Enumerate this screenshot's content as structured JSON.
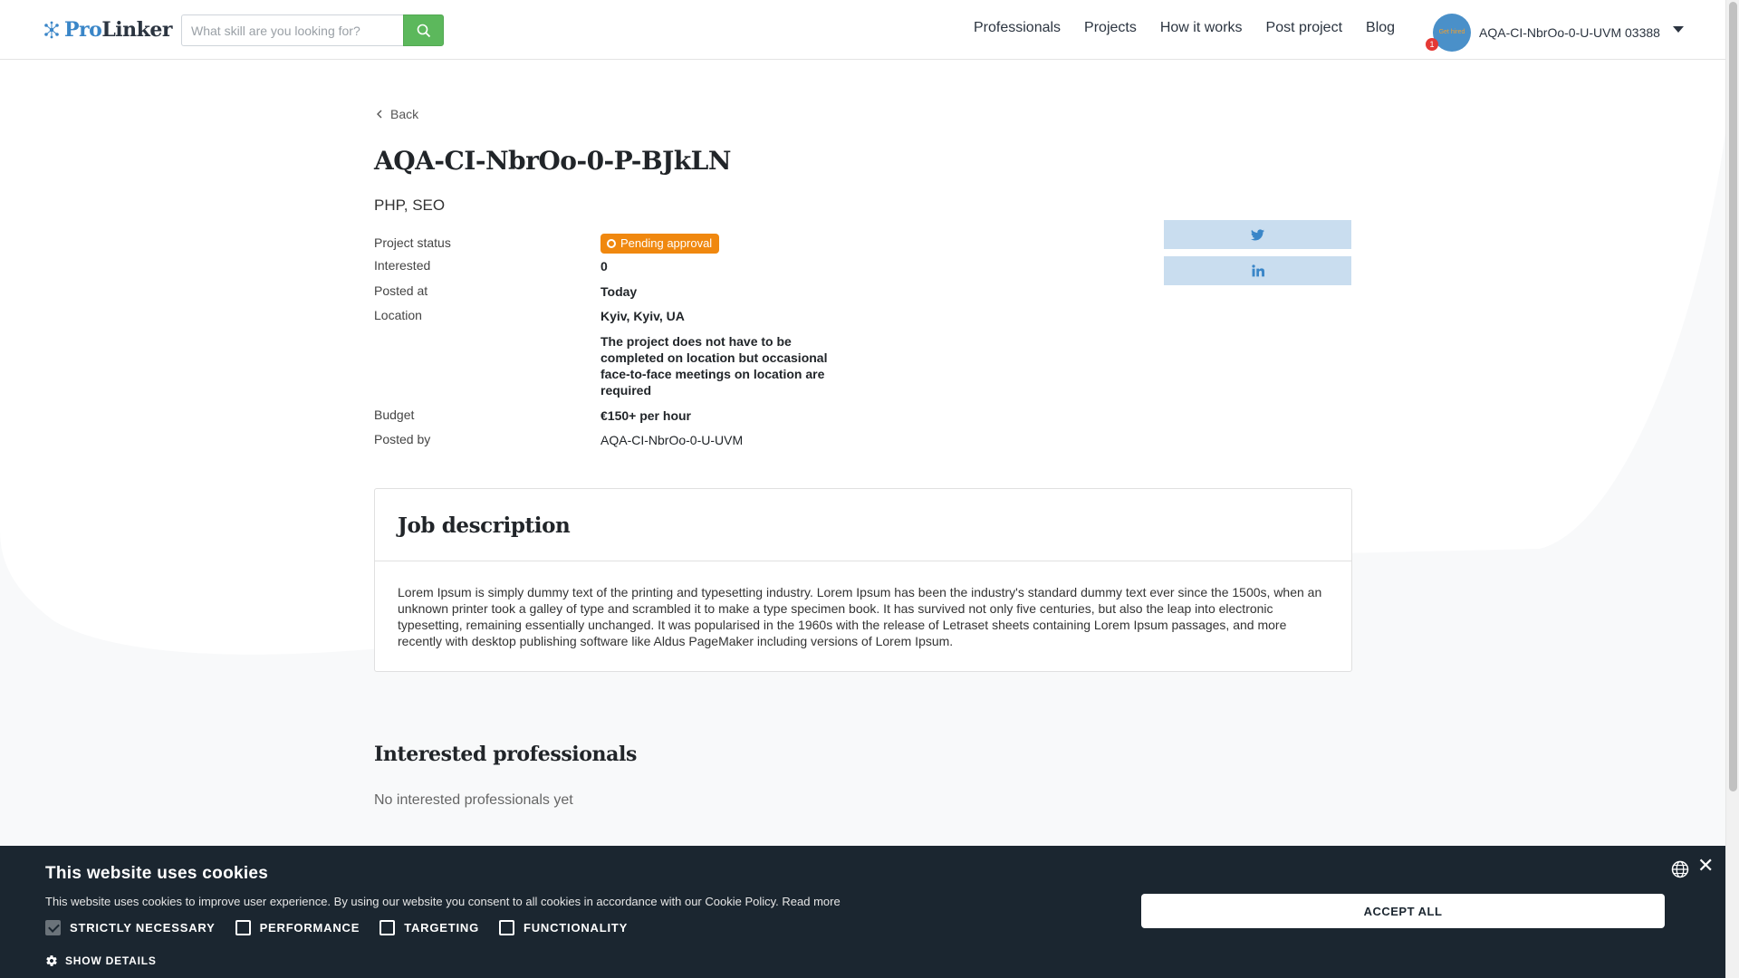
{
  "header": {
    "logo_part1": "Pro",
    "logo_part2": "Linker",
    "search_placeholder": "What skill are you looking for?",
    "nav": [
      "Professionals",
      "Projects",
      "How it works",
      "Post project",
      "Blog"
    ],
    "avatar_text": "Get hired",
    "notification_count": "1",
    "username": "AQA-CI-NbrOo-0-U-UVM 03388"
  },
  "project": {
    "back_label": "Back",
    "title": "AQA-CI-NbrOo-0-P-BJkLN",
    "skills": "PHP, SEO",
    "status_label": "Project status",
    "status_value": "Pending approval",
    "interested_label": "Interested",
    "interested_value": "0",
    "posted_at_label": "Posted at",
    "posted_at_value": "Today",
    "location_label": "Location",
    "location_value": "Kyiv, Kyiv, UA",
    "location_note": "The project does not have to be completed on location but occasional face-to-face meetings on location are required",
    "budget_label": "Budget",
    "budget_value": "€150+ per hour",
    "posted_by_label": "Posted by",
    "posted_by_value": "AQA-CI-NbrOo-0-U-UVM"
  },
  "job_description": {
    "heading": "Job description",
    "text": "Lorem Ipsum is simply dummy text of the printing and typesetting industry. Lorem Ipsum has been the industry's standard dummy text ever since the 1500s, when an unknown printer took a galley of type and scrambled it to make a type specimen book. It has survived not only five centuries, but also the leap into electronic typesetting, remaining essentially unchanged. It was popularised in the 1960s with the release of Letraset sheets containing Lorem Ipsum passages, and more recently with desktop publishing software like Aldus PageMaker including versions of Lorem Ipsum."
  },
  "interested": {
    "heading": "Interested professionals",
    "empty_text": "No interested professionals yet"
  },
  "cookie": {
    "title": "This website uses cookies",
    "description": "This website uses cookies to improve user experience. By using our website you consent to all cookies in accordance with our Cookie Policy.",
    "read_more": "Read more",
    "options": [
      {
        "label": "STRICTLY NECESSARY",
        "checked": true
      },
      {
        "label": "PERFORMANCE",
        "checked": false
      },
      {
        "label": "TARGETING",
        "checked": false
      },
      {
        "label": "FUNCTIONALITY",
        "checked": false
      }
    ],
    "show_details": "SHOW DETAILS",
    "accept_all": "ACCEPT ALL"
  },
  "colors": {
    "brand_blue": "#3a86c8",
    "search_green": "#5cb85c",
    "status_orange": "#f0880f",
    "share_bg": "#c9ddef",
    "cookie_bg": "#1b2630"
  }
}
